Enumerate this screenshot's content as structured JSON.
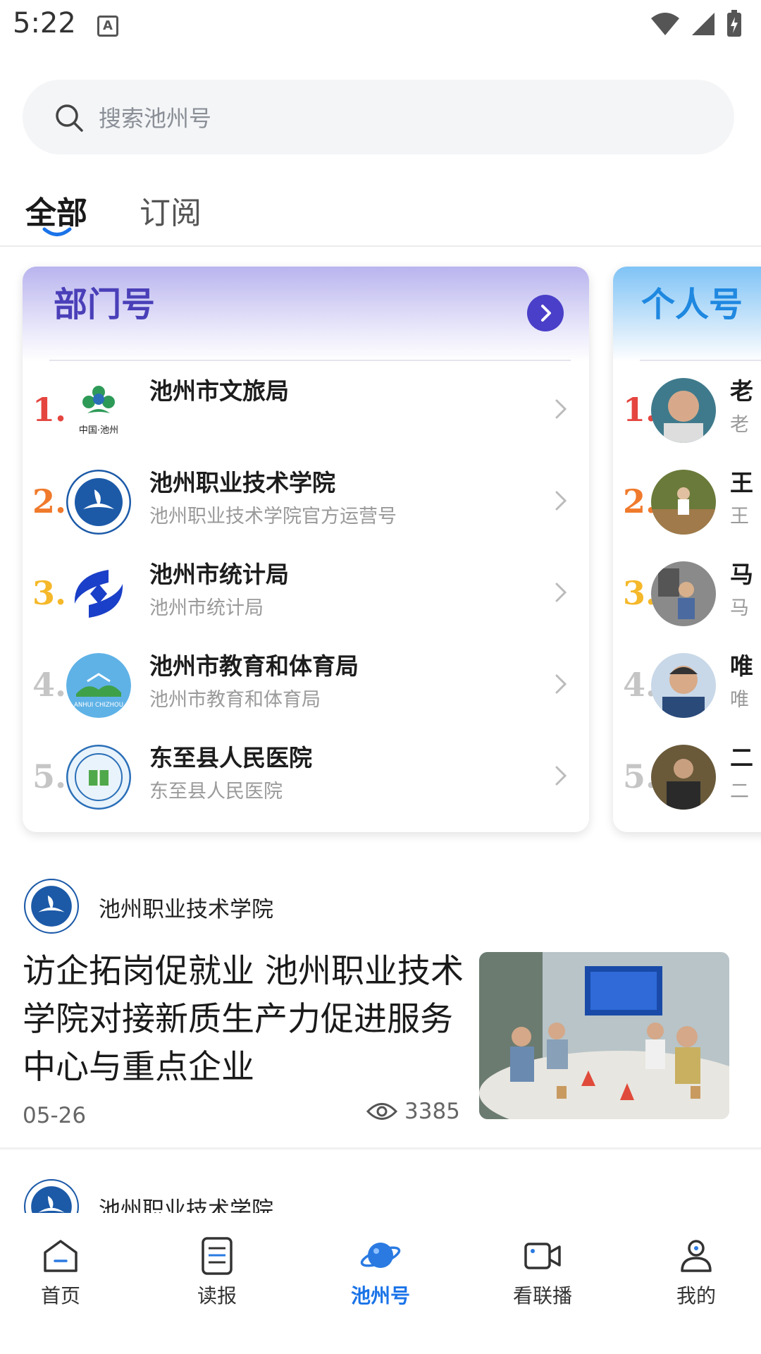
{
  "status_bar": {
    "time": "5:22",
    "notification_icon": "A"
  },
  "search": {
    "placeholder": "搜索池州号"
  },
  "tabs": [
    {
      "label": "全部"
    },
    {
      "label": "订阅"
    }
  ],
  "department_card": {
    "title": "部门号",
    "items": [
      {
        "rank": "1.",
        "name": "池州市文旅局",
        "desc": ""
      },
      {
        "rank": "2.",
        "name": "池州职业技术学院",
        "desc": "池州职业技术学院官方运营号"
      },
      {
        "rank": "3.",
        "name": "池州市统计局",
        "desc": "池州市统计局"
      },
      {
        "rank": "4.",
        "name": "池州市教育和体育局",
        "desc": "池州市教育和体育局"
      },
      {
        "rank": "5.",
        "name": "东至县人民医院",
        "desc": "东至县人民医院"
      }
    ]
  },
  "personal_card": {
    "title": "个人号",
    "items": [
      {
        "rank": "1.",
        "name": "老",
        "desc": "老"
      },
      {
        "rank": "2.",
        "name": "王",
        "desc": "王"
      },
      {
        "rank": "3.",
        "name": "马",
        "desc": "马"
      },
      {
        "rank": "4.",
        "name": "唯",
        "desc": "唯"
      },
      {
        "rank": "5.",
        "name": "二",
        "desc": "二"
      }
    ]
  },
  "logo_texts": {
    "chizhou_tourism": "中国·池州",
    "education": "ANHUI CHIZHOU"
  },
  "articles": [
    {
      "author": "池州职业技术学院",
      "title": "访企拓岗促就业 池州职业技术学院对接新质生产力促进服务中心与重点企业",
      "date": "05-26",
      "views": "3385"
    },
    {
      "author": "池州职业技术学院"
    }
  ],
  "bottom_nav": [
    {
      "label": "首页",
      "icon": "home-icon"
    },
    {
      "label": "读报",
      "icon": "newspaper-icon"
    },
    {
      "label": "池州号",
      "icon": "planet-icon",
      "active": true
    },
    {
      "label": "看联播",
      "icon": "video-icon"
    },
    {
      "label": "我的",
      "icon": "profile-icon"
    }
  ],
  "colors": {
    "accent": "#1a73e8",
    "dept_title": "#4a3fb8",
    "person_title": "#1f88e0"
  }
}
